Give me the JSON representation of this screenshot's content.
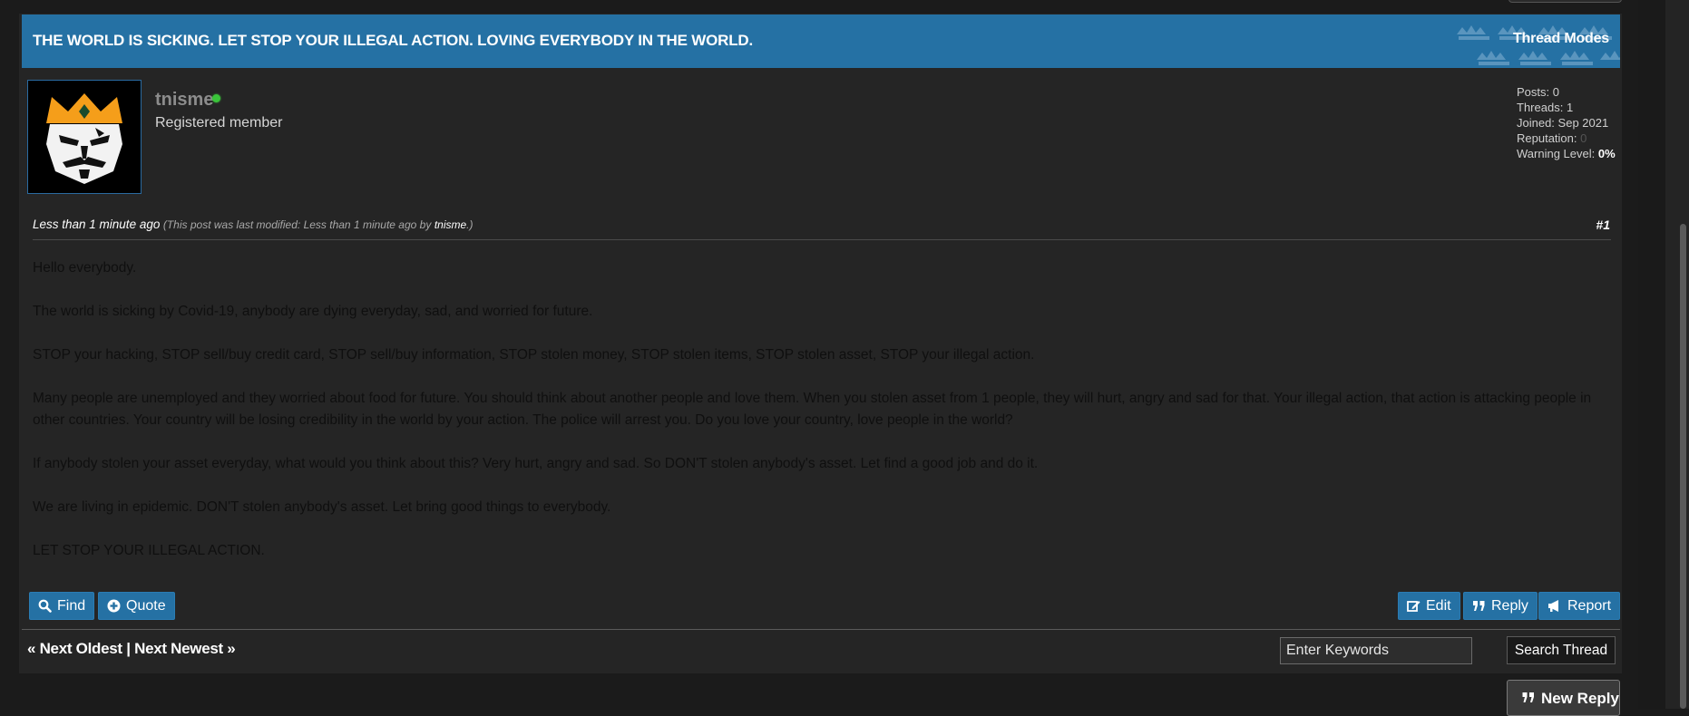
{
  "thread": {
    "title": "THE WORLD IS SICKING. LET STOP YOUR ILLEGAL ACTION. LOVING EVERYBODY IN THE WORLD.",
    "modes_label": "Thread Modes"
  },
  "author": {
    "username": "tnisme",
    "usertitle": "Registered member",
    "online_status": "online",
    "stats": {
      "posts_label": "Posts:",
      "posts": "0",
      "threads_label": "Threads:",
      "threads": "1",
      "joined_label": "Joined:",
      "joined": "Sep 2021",
      "reputation_label": "Reputation:",
      "reputation": "0",
      "warning_label": "Warning Level:",
      "warning": "0%"
    }
  },
  "post": {
    "date": "Less than 1 minute ago",
    "edit_prefix": "(This post was last modified: Less than 1 minute ago by",
    "edit_by": "tnisme",
    "edit_suffix": ".)",
    "number": "#1",
    "body": [
      "Hello everybody.",
      "The world is sicking by Covid-19, anybody are dying everyday, sad, and worried for future.",
      "STOP your hacking, STOP sell/buy credit card, STOP sell/buy information, STOP stolen money, STOP stolen items, STOP stolen asset, STOP your illegal action.",
      "Many people are unemployed and they worried about food for future. You should think about another people and love them. When you stolen asset from 1 people, they will hurt, angry and sad for that. Your illegal action, that action is attacking people in other countries. Your country will be losing credibility in the world by your action. The police will arrest you. Do you love your country, love people in the world?",
      "If anybody stolen your asset everyday, what would you think about this? Very hurt, angry and sad. So DON'T stolen anybody's asset. Let find a good job and do it.",
      "We are living in epidemic. DON'T stolen anybody's asset. Let bring good things to everybody.",
      "LET STOP YOUR ILLEGAL ACTION."
    ]
  },
  "buttons": {
    "find": "Find",
    "quote": "Quote",
    "edit": "Edit",
    "reply": "Reply",
    "report": "Report",
    "new_reply": "New Reply",
    "search_thread": "Search Thread"
  },
  "pager": {
    "next_oldest": "« Next Oldest",
    "separator": "|",
    "next_newest": "Next Newest »"
  },
  "search": {
    "placeholder": "Enter Keywords"
  },
  "colors": {
    "accent": "#2571a4",
    "background": "#1b1b1b",
    "panel": "#252525",
    "online": "#3ac43a"
  }
}
